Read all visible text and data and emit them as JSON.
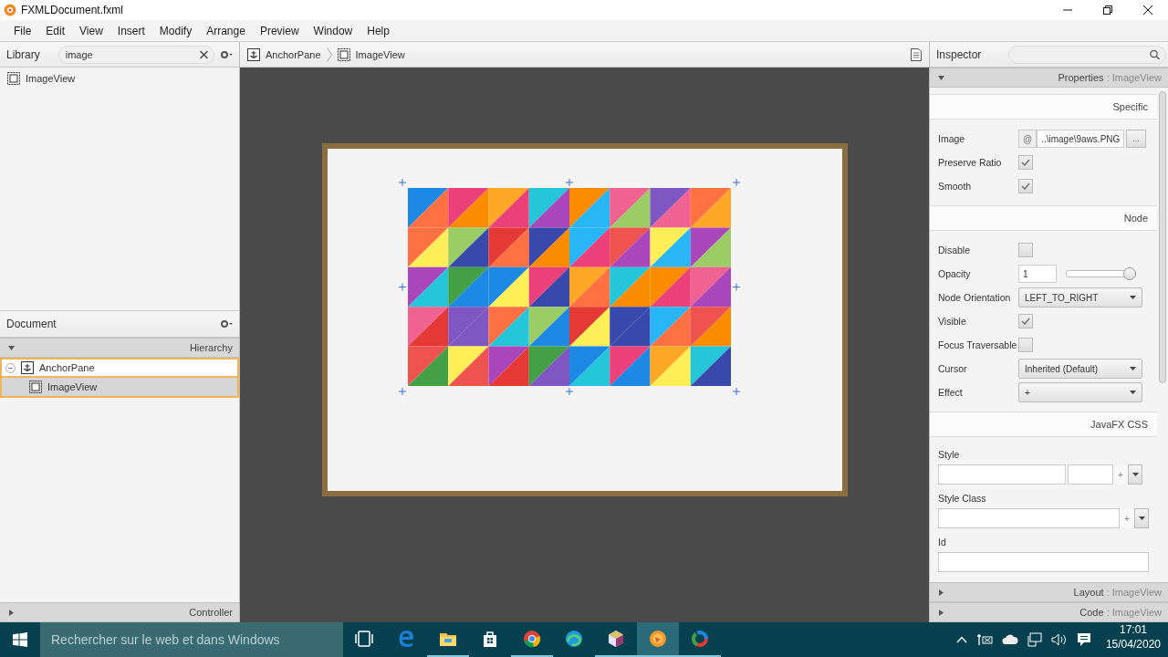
{
  "window": {
    "title": "FXMLDocument.fxml"
  },
  "menu": [
    "File",
    "Edit",
    "View",
    "Insert",
    "Modify",
    "Arrange",
    "Preview",
    "Window",
    "Help"
  ],
  "library": {
    "title": "Library",
    "search": {
      "value": "image"
    },
    "items": [
      {
        "label": "ImageView",
        "kind": "image"
      }
    ]
  },
  "breadcrumb": [
    {
      "label": "AnchorPane",
      "kind": "anchor"
    },
    {
      "label": "ImageView",
      "kind": "image"
    }
  ],
  "document": {
    "title": "Document",
    "section": "Hierarchy",
    "tree": [
      {
        "label": "AnchorPane",
        "kind": "anchor",
        "expanded": true,
        "selected": false,
        "children": [
          {
            "label": "ImageView",
            "kind": "image",
            "selected": true
          }
        ]
      }
    ],
    "controller": "Controller"
  },
  "inspector": {
    "title": "Inspector",
    "section": {
      "name": "Properties",
      "separator": ":",
      "target": "ImageView"
    },
    "groups": [
      {
        "title": "Specific",
        "props": [
          {
            "kind": "file",
            "label": "Image",
            "prefix": "@",
            "value": "..\\image\\9aws.PNG",
            "button": "..."
          },
          {
            "kind": "check",
            "label": "Preserve Ratio",
            "checked": true
          },
          {
            "kind": "check",
            "label": "Smooth",
            "checked": true
          }
        ]
      },
      {
        "title": "Node",
        "props": [
          {
            "kind": "check",
            "label": "Disable",
            "checked": false
          },
          {
            "kind": "slider",
            "label": "Opacity",
            "value": "1",
            "level": 1
          },
          {
            "kind": "select",
            "label": "Node Orientation",
            "value": "LEFT_TO_RIGHT"
          },
          {
            "kind": "check",
            "label": "Visible",
            "checked": true
          },
          {
            "kind": "check",
            "label": "Focus Traversable",
            "checked": false
          },
          {
            "kind": "select",
            "label": "Cursor",
            "value": "Inherited (Default)"
          },
          {
            "kind": "select",
            "label": "Effect",
            "value": "+"
          }
        ]
      },
      {
        "title": "JavaFX CSS",
        "props": [
          {
            "kind": "style",
            "label": "Style",
            "add": "+"
          },
          {
            "kind": "styleclass",
            "label": "Style Class",
            "add": "+"
          },
          {
            "kind": "text",
            "label": "Id"
          }
        ]
      }
    ],
    "collapsed": [
      {
        "name": "Layout",
        "separator": ":",
        "target": "ImageView"
      },
      {
        "name": "Code",
        "separator": ":",
        "target": "ImageView"
      }
    ]
  },
  "taskbar": {
    "search": {
      "placeholder": "Rechercher sur le web et dans Windows"
    },
    "apps": [
      {
        "kind": "taskview",
        "running": false,
        "selected": false
      },
      {
        "kind": "edge",
        "running": false,
        "selected": false
      },
      {
        "kind": "folder",
        "running": true,
        "selected": false
      },
      {
        "kind": "store",
        "running": false,
        "selected": false
      },
      {
        "kind": "chrome",
        "running": true,
        "selected": false
      },
      {
        "kind": "edgenew",
        "running": false,
        "selected": false
      },
      {
        "kind": "cube",
        "running": true,
        "selected": false
      },
      {
        "kind": "builder",
        "running": true,
        "selected": true
      },
      {
        "kind": "ring",
        "running": true,
        "selected": false
      }
    ],
    "time": "17:01",
    "date": "15/04/2020"
  }
}
